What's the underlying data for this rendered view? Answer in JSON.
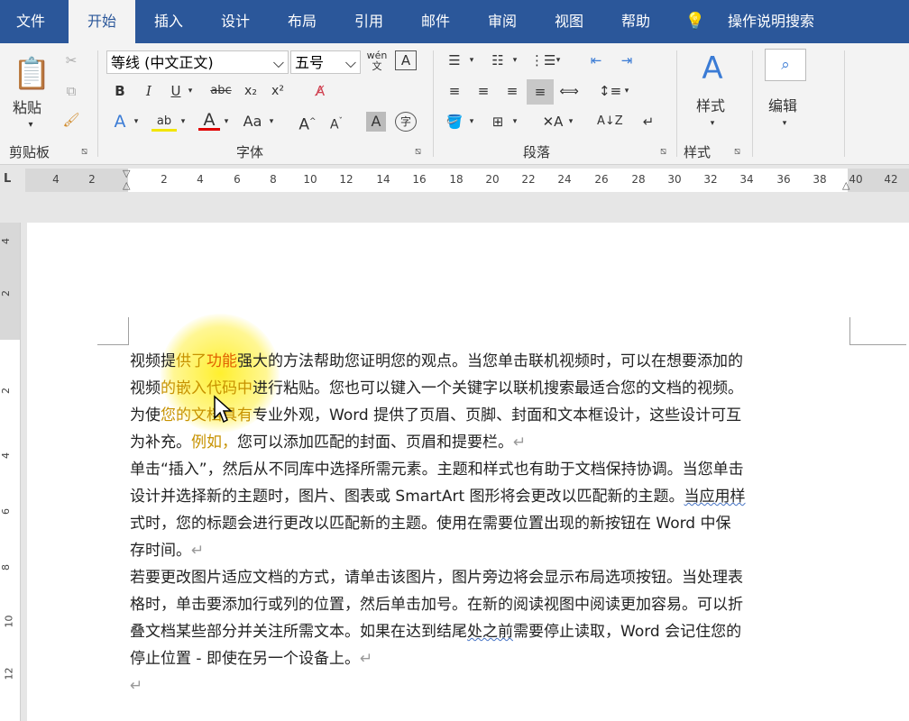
{
  "tabs": [
    "文件",
    "开始",
    "插入",
    "设计",
    "布局",
    "引用",
    "邮件",
    "审阅",
    "视图",
    "帮助"
  ],
  "active_tab": "开始",
  "search": {
    "label": "操作说明搜索",
    "icon": "lightbulb-icon"
  },
  "ribbon": {
    "clipboard": {
      "paste_label": "粘贴",
      "group_label": "剪贴板"
    },
    "font": {
      "font_name": "等线 (中文正文)",
      "font_size": "五号",
      "group_label": "字体"
    },
    "paragraph": {
      "group_label": "段落"
    },
    "styles": {
      "styles_label": "样式",
      "group_label": "样式"
    },
    "editing": {
      "label": "编辑"
    }
  },
  "ruler": {
    "h_ticks": [
      "4",
      "2",
      "2",
      "4",
      "6",
      "8",
      "10",
      "12",
      "14",
      "16",
      "18",
      "20",
      "22",
      "24",
      "26",
      "28",
      "30",
      "32",
      "34",
      "36",
      "38",
      "40",
      "42"
    ],
    "v_ticks": [
      "4",
      "2",
      "2",
      "4",
      "6",
      "8",
      "10",
      "12"
    ],
    "corner_symbol": "L"
  },
  "document": {
    "lines": [
      {
        "before": "视频提",
        "hl": "供了",
        "hl2": "功能",
        "after": "强大的方法帮助您证明您的观点。当您单击联机视频时，可以在想要添加的"
      },
      {
        "before": "视频",
        "hl": "的嵌入代码中",
        "hl2": "",
        "after": "进行粘贴。您也可以键入一个关键字以联机搜索最适合您的文档的视频。"
      },
      {
        "before": "为使",
        "hl": "您的文档具有",
        "hl2": "",
        "after": "专业外观，Word 提供了页眉、页脚、封面和文本框设计，这些设计可互"
      },
      {
        "before": "为补充。",
        "hl": "例如，",
        "hl2": "",
        "after": "您可以添加匹配的封面、页眉和提要栏。",
        "mark": "↵"
      },
      {
        "before": "单击“插入”，然后从不同库中选择所需元素。主题和样式也有助于文档保持协调。当您单击",
        "hl": "",
        "hl2": "",
        "after": ""
      },
      {
        "before": "设计并选择新的主题时，图片、图表或 SmartArt 图形将会更改以匹配新的主题。",
        "hl": "",
        "hl2": "",
        "after": "",
        "squig": "当应用样"
      },
      {
        "before": "式时，您的标题会进行更改以匹配新的主题。使用在需要位置出现的新按钮在 Word 中保",
        "hl": "",
        "hl2": "",
        "after": ""
      },
      {
        "before": "存时间。",
        "hl": "",
        "hl2": "",
        "after": "",
        "mark": "↵"
      },
      {
        "before": "若要更改图片适应文档的方式，请单击该图片，图片旁边将会显示布局选项按钮。当处理表",
        "hl": "",
        "hl2": "",
        "after": ""
      },
      {
        "before": "格时，单击要添加行或列的位置，然后单击加号。在新的阅读视图中阅读更加容易。可以折",
        "hl": "",
        "hl2": "",
        "after": ""
      },
      {
        "before": "叠文档某些部分并关注所需文本。如果在达到结尾",
        "hl": "",
        "hl2": "",
        "after": "需要停止读取，Word 会记住您的",
        "squig": "处之前"
      },
      {
        "before": "停止位置 - 即使在另一个设备上。",
        "hl": "",
        "hl2": "",
        "after": "",
        "mark": "↵"
      },
      {
        "before": "",
        "hl": "",
        "hl2": "",
        "after": "",
        "mark": "↵"
      }
    ]
  },
  "cursor": "mouse-pointer-icon"
}
